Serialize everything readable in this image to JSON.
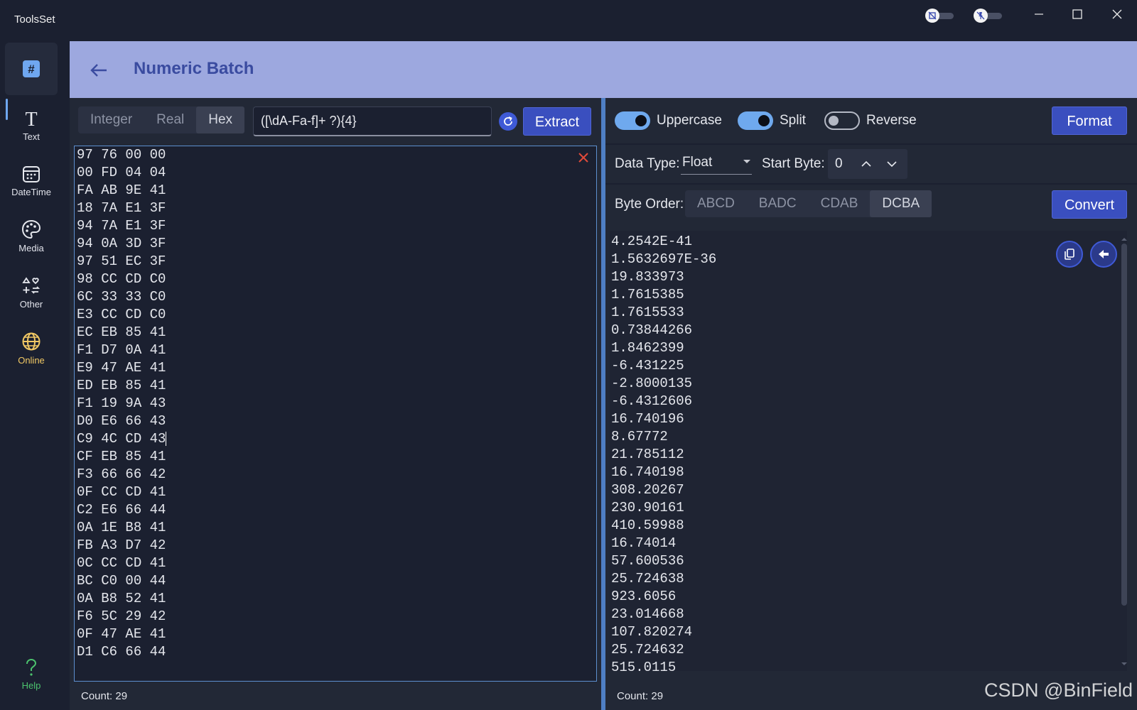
{
  "app": {
    "title": "ToolsSet",
    "titlebar_icons": [
      "image-off-icon",
      "pin-off-icon"
    ],
    "window_controls": [
      "minimize-icon",
      "maximize-icon",
      "close-icon"
    ]
  },
  "sidebar": {
    "items": [
      {
        "label": "",
        "icon": "hash-icon",
        "active": true
      },
      {
        "label": "Text",
        "icon": "text-icon"
      },
      {
        "label": "DateTime",
        "icon": "calendar-icon"
      },
      {
        "label": "Media",
        "icon": "palette-icon"
      },
      {
        "label": "Other",
        "icon": "other-tools-icon"
      },
      {
        "label": "Online",
        "icon": "globe-icon",
        "color": "#f1c864"
      }
    ],
    "help": {
      "label": "Help",
      "icon": "question-icon",
      "color": "#4cc36e"
    }
  },
  "header": {
    "title": "Numeric Batch"
  },
  "left": {
    "modes": [
      "Integer",
      "Real",
      "Hex"
    ],
    "selected_mode": "Hex",
    "regex": "([\\dA-Fa-f]+ ?){4}",
    "extract_label": "Extract",
    "lines": [
      "97 76 00 00",
      "00 FD 04 04",
      "FA AB 9E 41",
      "18 7A E1 3F",
      "94 7A E1 3F",
      "94 0A 3D 3F",
      "97 51 EC 3F",
      "98 CC CD C0",
      "6C 33 33 C0",
      "E3 CC CD C0",
      "EC EB 85 41",
      "F1 D7 0A 41",
      "E9 47 AE 41",
      "ED EB 85 41",
      "F1 19 9A 43",
      "D0 E6 66 43",
      "C9 4C CD 43",
      "CF EB 85 41",
      "F3 66 66 42",
      "0F CC CD 41",
      "C2 E6 66 44",
      "0A 1E B8 41",
      "FB A3 D7 42",
      "0C CC CD 41",
      "BC C0 00 44",
      "0A B8 52 41",
      "F6 5C 29 42",
      "0F 47 AE 41",
      "D1 C6 66 44"
    ],
    "count": "Count: 29"
  },
  "right": {
    "toggles": [
      {
        "label": "Uppercase",
        "on": true
      },
      {
        "label": "Split",
        "on": true
      },
      {
        "label": "Reverse",
        "on": false
      }
    ],
    "format_label": "Format",
    "data_type_label": "Data Type:",
    "data_type_value": "Float",
    "start_byte_label": "Start Byte:",
    "start_byte_value": "0",
    "byte_order_label": "Byte Order:",
    "byte_orders": [
      "ABCD",
      "BADC",
      "CDAB",
      "DCBA"
    ],
    "selected_byte_order": "DCBA",
    "convert_label": "Convert",
    "results": [
      "4.2542E-41",
      "1.5632697E-36",
      "19.833973",
      "1.7615385",
      "1.7615533",
      "0.73844266",
      "1.8462399",
      "-6.431225",
      "-2.8000135",
      "-6.4312606",
      "16.740196",
      "8.67772",
      "21.785112",
      "16.740198",
      "308.20267",
      "230.90161",
      "410.59988",
      "16.74014",
      "57.600536",
      "25.724638",
      "923.6056",
      "23.014668",
      "107.820274",
      "25.724632",
      "515.0115"
    ],
    "count": "Count: 29",
    "action_icons": [
      "copy-icon",
      "send-back-icon"
    ]
  },
  "watermark": "CSDN @BinField",
  "colors": {
    "header_bg": "#9da8df",
    "accent": "#3a4fbf",
    "title": "#3a4ba0",
    "online": "#f1c864",
    "help": "#4cc36e"
  }
}
